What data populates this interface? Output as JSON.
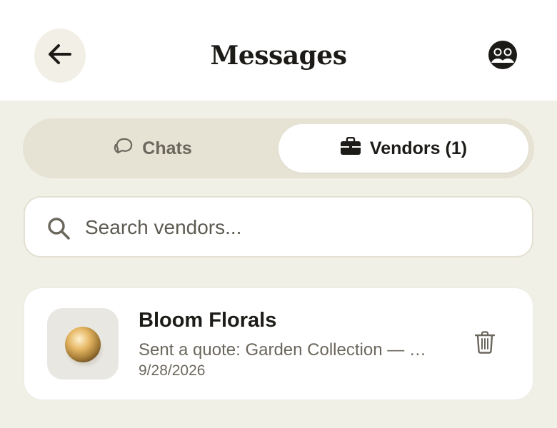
{
  "header": {
    "title": "Messages",
    "back_icon": "arrow-left-icon",
    "profile_icon": "users-icon"
  },
  "tabs": [
    {
      "label": "Chats",
      "icon": "chat-bubbles-icon",
      "active": false
    },
    {
      "label": "Vendors (1)",
      "icon": "briefcase-icon",
      "active": true
    }
  ],
  "search": {
    "placeholder": "Search vendors...",
    "value": ""
  },
  "vendors": [
    {
      "name": "Bloom Florals",
      "preview": "Sent a quote: Garden Collection — …",
      "date": "9/28/2026",
      "action_icon": "trash-icon"
    }
  ],
  "colors": {
    "background": "#f1f0e7",
    "surface": "#ffffff",
    "tab_track": "#e6e2d4",
    "text_primary": "#1c1b17",
    "text_muted": "#6b675d"
  }
}
